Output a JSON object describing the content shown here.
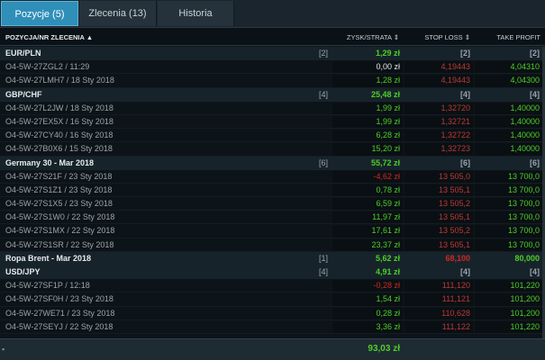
{
  "tabs": [
    {
      "label": "Pozycje (5)",
      "active": true
    },
    {
      "label": "Zlecenia (13)",
      "active": false
    },
    {
      "label": "Historia",
      "active": false
    }
  ],
  "header": {
    "name": "POZYCJA/NR ZLECENIA ▲",
    "pl": "ZYSK/STRATA ⇕",
    "sl": "STOP LOSS ⇕",
    "tp": "TAKE PROFIT"
  },
  "rows": [
    {
      "type": "group",
      "name": "EUR/PLN",
      "count": "[2]",
      "pl": "1,29 zł",
      "pl_class": "green",
      "sl": "[2]",
      "sl_class": "grey",
      "tp": "[2]",
      "tp_class": "grey"
    },
    {
      "type": "pos",
      "name": "O4-5W-27ZGL2 / 11:29",
      "pl": "0,00 zł",
      "pl_class": "white",
      "sl": "4,19443",
      "sl_class": "darkred",
      "tp": "4,04310",
      "tp_class": "green"
    },
    {
      "type": "pos",
      "name": "O4-5W-27LMH7 / 18 Sty 2018",
      "pl": "1,28 zł",
      "pl_class": "green",
      "sl": "4,19443",
      "sl_class": "darkred",
      "tp": "4,04300",
      "tp_class": "green"
    },
    {
      "type": "group",
      "name": "GBP/CHF",
      "count": "[4]",
      "pl": "25,48 zł",
      "pl_class": "green",
      "sl": "[4]",
      "sl_class": "grey",
      "tp": "[4]",
      "tp_class": "grey"
    },
    {
      "type": "pos",
      "name": "O4-5W-27L2JW / 18 Sty 2018",
      "pl": "1,99 zł",
      "pl_class": "green",
      "sl": "1,32720",
      "sl_class": "darkred",
      "tp": "1,40000",
      "tp_class": "green"
    },
    {
      "type": "pos",
      "name": "O4-5W-27EX5X / 16 Sty 2018",
      "pl": "1,99 zł",
      "pl_class": "green",
      "sl": "1,32721",
      "sl_class": "darkred",
      "tp": "1,40000",
      "tp_class": "green"
    },
    {
      "type": "pos",
      "name": "O4-5W-27CY40 / 16 Sty 2018",
      "pl": "6,28 zł",
      "pl_class": "green",
      "sl": "1,32722",
      "sl_class": "darkred",
      "tp": "1,40000",
      "tp_class": "green"
    },
    {
      "type": "pos",
      "name": "O4-5W-27B0X6 / 15 Sty 2018",
      "pl": "15,20 zł",
      "pl_class": "green",
      "sl": "1,32723",
      "sl_class": "darkred",
      "tp": "1,40000",
      "tp_class": "green"
    },
    {
      "type": "group",
      "name": "Germany 30 - Mar 2018",
      "count": "[6]",
      "pl": "55,72 zł",
      "pl_class": "green",
      "sl": "[6]",
      "sl_class": "grey",
      "tp": "[6]",
      "tp_class": "grey"
    },
    {
      "type": "pos",
      "name": "O4-5W-27S21F / 23 Sty 2018",
      "pl": "-4,62 zł",
      "pl_class": "red",
      "sl": "13 505,0",
      "sl_class": "darkred",
      "tp": "13 700,0",
      "tp_class": "green"
    },
    {
      "type": "pos",
      "name": "O4-5W-27S1Z1 / 23 Sty 2018",
      "pl": "0,78 zł",
      "pl_class": "green",
      "sl": "13 505,1",
      "sl_class": "darkred",
      "tp": "13 700,0",
      "tp_class": "green"
    },
    {
      "type": "pos",
      "name": "O4-5W-27S1X5 / 23 Sty 2018",
      "pl": "6,59 zł",
      "pl_class": "green",
      "sl": "13 505,2",
      "sl_class": "darkred",
      "tp": "13 700,0",
      "tp_class": "green"
    },
    {
      "type": "pos",
      "name": "O4-5W-27S1W0 / 22 Sty 2018",
      "pl": "11,97 zł",
      "pl_class": "green",
      "sl": "13 505,1",
      "sl_class": "darkred",
      "tp": "13 700,0",
      "tp_class": "green"
    },
    {
      "type": "pos",
      "name": "O4-5W-27S1MX / 22 Sty 2018",
      "pl": "17,61 zł",
      "pl_class": "green",
      "sl": "13 505,2",
      "sl_class": "darkred",
      "tp": "13 700,0",
      "tp_class": "green"
    },
    {
      "type": "pos",
      "name": "O4-5W-27S1SR / 22 Sty 2018",
      "pl": "23,37 zł",
      "pl_class": "green",
      "sl": "13 505,1",
      "sl_class": "darkred",
      "tp": "13 700,0",
      "tp_class": "green"
    },
    {
      "type": "group",
      "name": "Ropa Brent - Mar 2018",
      "count": "[1]",
      "pl": "5,62 zł",
      "pl_class": "green",
      "sl": "68,100",
      "sl_class": "red",
      "tp": "80,000",
      "tp_class": "green"
    },
    {
      "type": "group",
      "name": "USD/JPY",
      "count": "[4]",
      "pl": "4,91 zł",
      "pl_class": "green",
      "sl": "[4]",
      "sl_class": "grey",
      "tp": "[4]",
      "tp_class": "grey"
    },
    {
      "type": "pos",
      "name": "O4-5W-27SF1P / 12:18",
      "pl": "-0,28 zł",
      "pl_class": "red",
      "sl": "111,120",
      "sl_class": "darkred",
      "tp": "101,220",
      "tp_class": "green"
    },
    {
      "type": "pos",
      "name": "O4-5W-27SF0H / 23 Sty 2018",
      "pl": "1,54 zł",
      "pl_class": "green",
      "sl": "111,121",
      "sl_class": "darkred",
      "tp": "101,200",
      "tp_class": "green"
    },
    {
      "type": "pos",
      "name": "O4-5W-27WE71 / 23 Sty 2018",
      "pl": "0,28 zł",
      "pl_class": "green",
      "sl": "110,628",
      "sl_class": "darkred",
      "tp": "101,200",
      "tp_class": "green"
    },
    {
      "type": "pos",
      "name": "O4-5W-27SEYJ / 22 Sty 2018",
      "pl": "3,36 zł",
      "pl_class": "green",
      "sl": "111,122",
      "sl_class": "darkred",
      "tp": "101,220",
      "tp_class": "green"
    }
  ],
  "footer": {
    "total": "93,03 zł"
  },
  "colors": {
    "active_tab": "#2f8fb8",
    "profit": "#4ccf27",
    "loss": "#cc2a24",
    "background": "#0d1419"
  }
}
